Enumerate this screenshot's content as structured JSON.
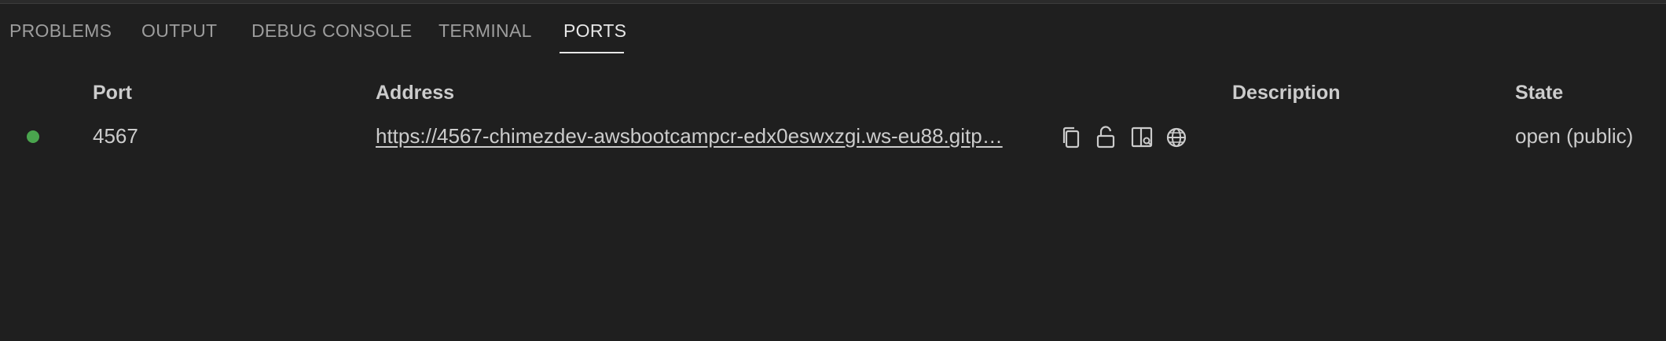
{
  "panel": {
    "tabs": [
      {
        "label": "PROBLEMS"
      },
      {
        "label": "OUTPUT"
      },
      {
        "label": "DEBUG CONSOLE"
      },
      {
        "label": "TERMINAL"
      },
      {
        "label": "PORTS",
        "active": true
      }
    ]
  },
  "ports_table": {
    "columns": {
      "port": "Port",
      "address": "Address",
      "description": "Description",
      "state": "State"
    },
    "rows": [
      {
        "status_color": "#4aa54e",
        "port": "4567",
        "address": "https://4567-chimezdev-awsbootcampcr-edx0eswxzgi.ws-eu88.gitp…",
        "description": "",
        "state": "open (public)",
        "actions": [
          "copy-icon",
          "unlock-icon",
          "preview-icon",
          "globe-icon"
        ]
      }
    ]
  }
}
